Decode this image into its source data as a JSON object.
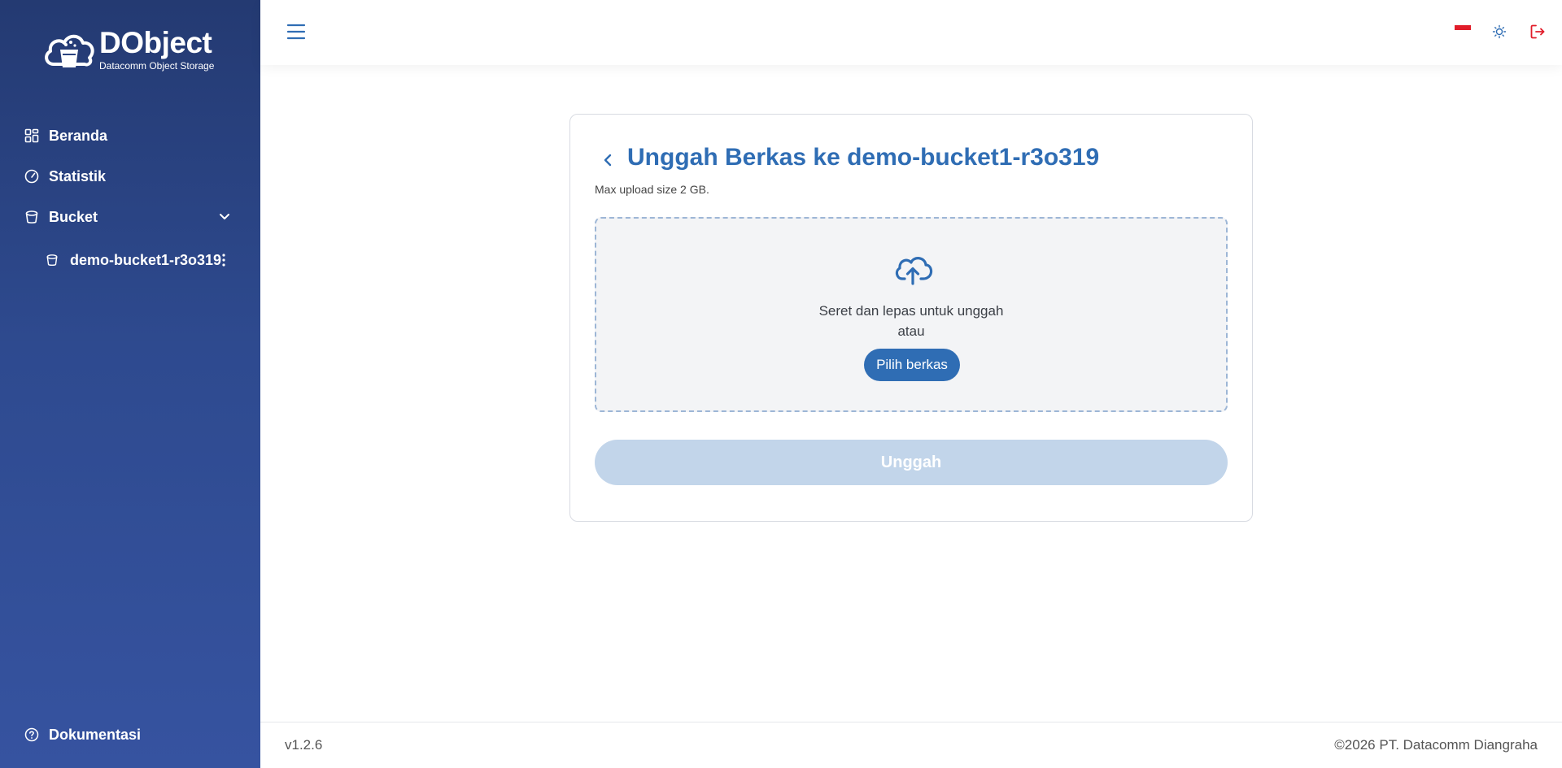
{
  "brand": {
    "title": "DObject",
    "subtitle": "Datacomm Object Storage"
  },
  "sidebar": {
    "items": [
      {
        "label": "Beranda",
        "icon": "dashboard-icon"
      },
      {
        "label": "Statistik",
        "icon": "gauge-icon"
      },
      {
        "label": "Bucket",
        "icon": "bucket-icon",
        "expanded": true
      },
      {
        "label": "Dokumentasi",
        "icon": "help-circle-icon"
      }
    ],
    "bucket_children": [
      {
        "label": "demo-bucket1-r3o319",
        "icon": "bucket-icon"
      }
    ]
  },
  "topbar": {
    "menu_icon": "hamburger-icon",
    "language_flag": "indonesia-flag-icon",
    "theme_icon": "sun-icon",
    "logout_icon": "logout-icon"
  },
  "upload": {
    "title": "Unggah Berkas ke demo-bucket1-r3o319",
    "max_size_note": "Max upload size 2 GB.",
    "dropzone_text": "Seret dan lepas untuk unggah",
    "dropzone_or": "atau",
    "choose_button": "Pilih berkas",
    "upload_button": "Unggah"
  },
  "footer": {
    "version": "v1.2.6",
    "copyright": "©2026 PT. Datacomm Diangraha"
  },
  "colors": {
    "primary": "#2f6db4",
    "sidebar_top": "#243a72",
    "sidebar_bottom": "#3653a0",
    "upload_disabled": "#c2d5ea",
    "logout": "#e11d2a"
  }
}
